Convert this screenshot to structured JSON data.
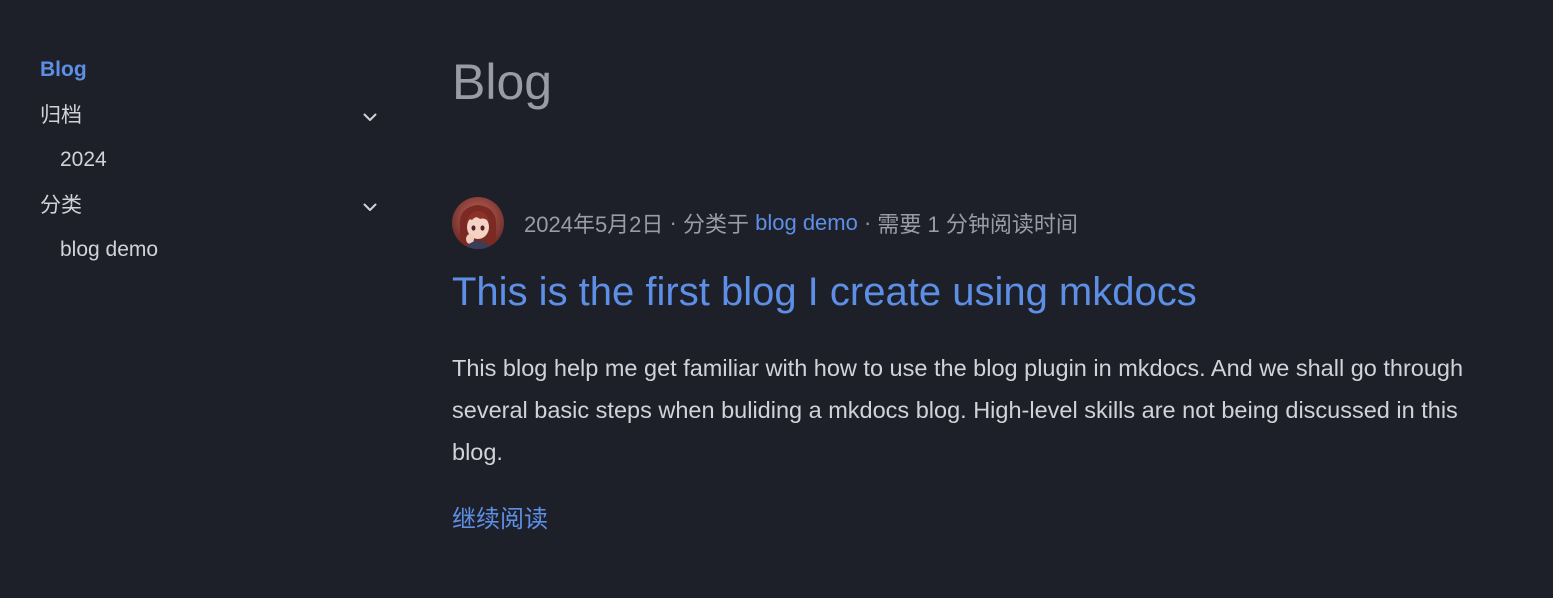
{
  "sidebar": {
    "blog_label": "Blog",
    "archive": {
      "label": "归档",
      "items": [
        "2024"
      ]
    },
    "categories": {
      "label": "分类",
      "items": [
        "blog demo"
      ]
    }
  },
  "main": {
    "title": "Blog",
    "post": {
      "date": "2024年5月2日",
      "separator1": " · ",
      "category_prefix": "分类于 ",
      "category": "blog demo",
      "separator2": " · ",
      "reading_time": "需要 1 分钟阅读时间",
      "title": "This is the first blog I create using mkdocs",
      "excerpt": "This blog help me get familiar with how to use the blog plugin in mkdocs. And we shall go through several basic steps when buliding a mkdocs blog. High-level skills are not being discussed in this blog.",
      "read_more": "继续阅读"
    }
  },
  "colors": {
    "background": "#1e2029",
    "accent": "#5d8fe6",
    "text": "#d2d3d8",
    "muted": "#9a9ca5"
  },
  "icons": {
    "chevron": "chevron-down-icon",
    "avatar": "author-avatar"
  }
}
